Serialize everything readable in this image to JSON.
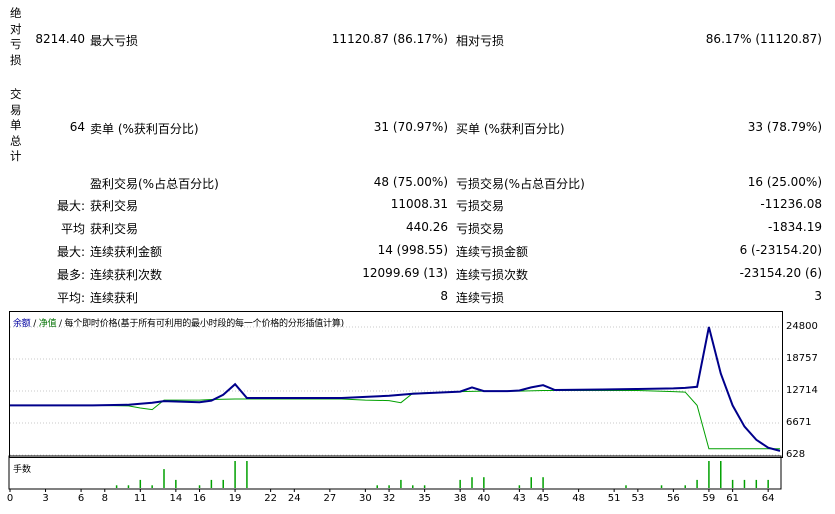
{
  "stats": {
    "abs_drawdown_label": "绝对亏损",
    "abs_drawdown_value": "8214.40",
    "max_drawdown_label": "最大亏损",
    "max_drawdown_value": "11120.87 (86.17%)",
    "rel_drawdown_label": "相对亏损",
    "rel_drawdown_value": "86.17% (11120.87)",
    "total_trades_label": "交易单总计",
    "total_trades_value": "64",
    "short_label": "卖单 (%获利百分比)",
    "short_value": "31 (70.97%)",
    "long_label": "买单 (%获利百分比)",
    "long_value": "33 (78.79%)",
    "profit_trades_label": "盈利交易(%占总百分比)",
    "profit_trades_value": "48 (75.00%)",
    "loss_trades_label": "亏损交易(%占总百分比)",
    "loss_trades_value": "16 (25.00%)",
    "largest_prefix": "最大:",
    "largest_profit_label": "获利交易",
    "largest_profit_value": "11008.31",
    "largest_loss_label": "亏损交易",
    "largest_loss_value": "-11236.08",
    "average_prefix": "平均",
    "average_profit_label": "获利交易",
    "average_profit_value": "440.26",
    "average_loss_label": "亏损交易",
    "average_loss_value": "-1834.19",
    "max_consec_prefix": "最大:",
    "max_consec_wins_label": "连续获利金额",
    "max_consec_wins_value": "14 (998.55)",
    "max_consec_losses_label": "连续亏损金额",
    "max_consec_losses_value": "6 (-23154.20)",
    "maximal_prefix": "最多:",
    "maximal_consec_profit_label": "连续获利次数",
    "maximal_consec_profit_value": "12099.69 (13)",
    "maximal_consec_loss_label": "连续亏损次数",
    "maximal_consec_loss_value": "-23154.20 (6)",
    "avg_consec_prefix": "平均:",
    "avg_consec_wins_label": "连续获利",
    "avg_consec_wins_value": "8",
    "avg_consec_losses_label": "连续亏损",
    "avg_consec_losses_value": "3"
  },
  "legend": {
    "balance": "余额",
    "separator1": " / ",
    "equity": "净值",
    "separator2": " / ",
    "model": "每个即时价格(基于所有可利用的最小时段的每一个价格的分形插值计算)"
  },
  "volume_title": "手数",
  "colors": {
    "balance_line": "#00008b",
    "equity_line": "#00a000",
    "volume_bar": "#00a000",
    "grid": "#c8c8c8"
  },
  "chart_data": {
    "type": "line",
    "x_ticks": [
      "0",
      "3",
      "6",
      "8",
      "11",
      "14",
      "16",
      "19",
      "22",
      "24",
      "27",
      "30",
      "32",
      "35",
      "38",
      "40",
      "43",
      "45",
      "48",
      "51",
      "53",
      "56",
      "59",
      "61",
      "64"
    ],
    "y_ticks": [
      "24800",
      "18757",
      "12714",
      "6671",
      "628"
    ],
    "ylim": [
      628,
      24800
    ],
    "xlim": [
      0,
      65
    ],
    "series": [
      {
        "name": "余额",
        "x": [
          0,
          7,
          10,
          11,
          12,
          13,
          16,
          17,
          18,
          19,
          20,
          28,
          30,
          32,
          34,
          38,
          39,
          40,
          42,
          43,
          44,
          45,
          46,
          50,
          53,
          56,
          57,
          58,
          59,
          60,
          61,
          62,
          63,
          64,
          65
        ],
        "values": [
          10000,
          10000,
          10100,
          10300,
          10500,
          10800,
          10600,
          10900,
          12000,
          14000,
          11400,
          11400,
          11600,
          11800,
          12200,
          12600,
          13400,
          12700,
          12700,
          12800,
          13400,
          13800,
          12900,
          13000,
          13100,
          13200,
          13300,
          13500,
          24800,
          16000,
          10000,
          6000,
          3500,
          2000,
          1400
        ]
      },
      {
        "name": "净值",
        "x": [
          0,
          7,
          10,
          11,
          12,
          13,
          16,
          17,
          19,
          20,
          28,
          30,
          32,
          33,
          34,
          38,
          40,
          43,
          45,
          48,
          53,
          56,
          57,
          58,
          59,
          60,
          65
        ],
        "values": [
          10000,
          10000,
          9900,
          9500,
          9200,
          11000,
          11000,
          11100,
          11200,
          11200,
          11200,
          11000,
          10900,
          10500,
          12300,
          12600,
          12700,
          12700,
          12800,
          12800,
          12800,
          12600,
          12500,
          10000,
          1800,
          1800,
          1800
        ]
      }
    ],
    "volume": {
      "x": [
        9,
        10,
        11,
        12,
        13,
        14,
        16,
        17,
        18,
        19,
        20,
        31,
        32,
        33,
        34,
        35,
        38,
        39,
        40,
        43,
        44,
        45,
        52,
        55,
        57,
        58,
        59,
        60,
        61,
        62,
        63,
        64
      ],
      "values": [
        1,
        1,
        3,
        1,
        7,
        3,
        1,
        3,
        3,
        10,
        10,
        1,
        1,
        3,
        1,
        1,
        3,
        4,
        4,
        1,
        4,
        4,
        1,
        1,
        1,
        3,
        10,
        10,
        3,
        3,
        3,
        3
      ],
      "max": 10
    }
  }
}
